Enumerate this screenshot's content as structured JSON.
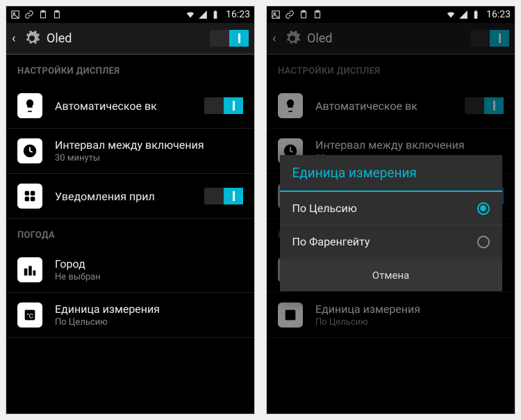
{
  "statusbar": {
    "time": "16:23"
  },
  "actionbar": {
    "title": "Oled",
    "main_toggle": true
  },
  "sections": {
    "display": {
      "header": "НАСТРОЙКИ ДИСПЛЕЯ",
      "auto_on": {
        "title": "Автоматическое вк",
        "toggle": true
      },
      "interval": {
        "title": "Интервал между включения",
        "sub": "30 минуты"
      },
      "notifications": {
        "title": "Уведомления прил",
        "toggle": true
      }
    },
    "weather": {
      "header": "ПОГОДА",
      "city": {
        "title": "Город",
        "sub": "Не выбран"
      },
      "unit": {
        "title": "Единица измерения",
        "sub": "По Цельсию"
      }
    }
  },
  "dialog": {
    "title": "Единица измерения",
    "options": [
      {
        "label": "По Цельсию",
        "checked": true
      },
      {
        "label": "По Фаренгейту",
        "checked": false
      }
    ],
    "cancel": "Отмена"
  }
}
